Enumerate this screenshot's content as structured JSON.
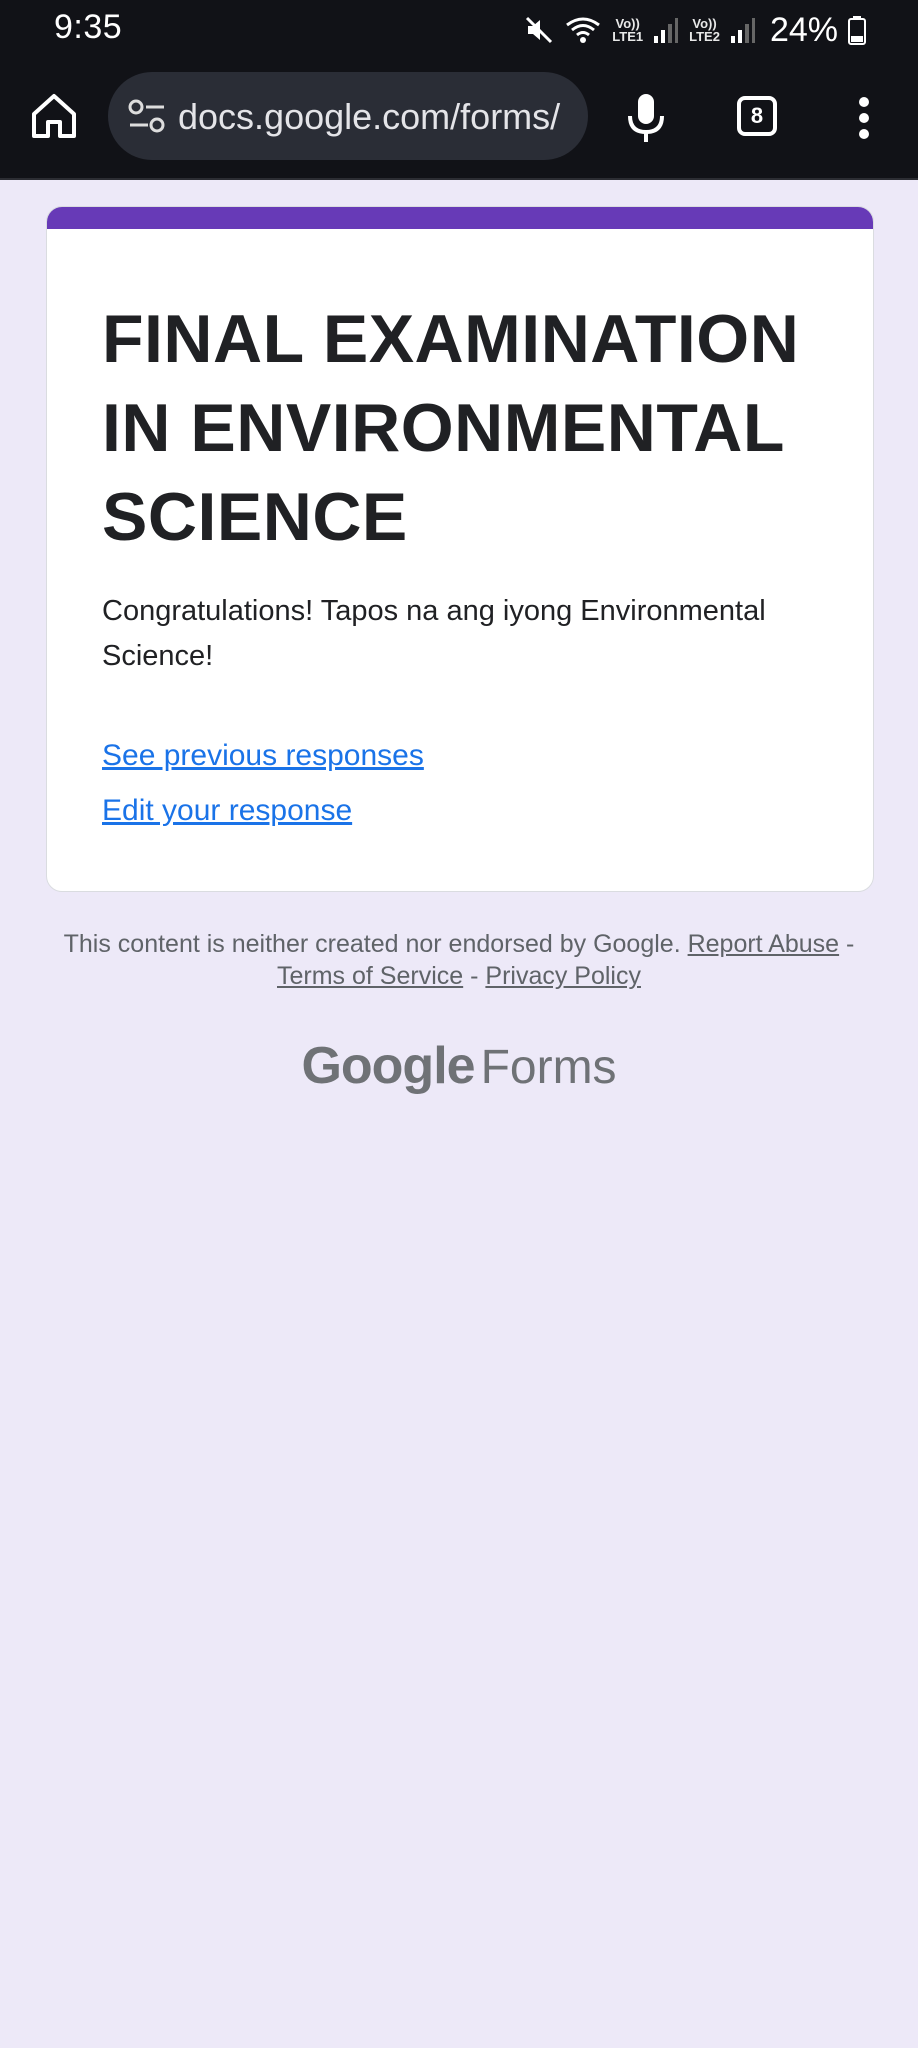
{
  "status_bar": {
    "time": "9:35",
    "net1_top": "Vo))",
    "net1_bottom": "LTE1",
    "net2_top": "Vo))",
    "net2_bottom": "LTE2",
    "battery": "24%"
  },
  "browser": {
    "url": "docs.google.com/forms/",
    "tab_count": "8"
  },
  "form": {
    "title": "FINAL EXAMINATION IN ENVIRONMENTAL SCIENCE",
    "confirmation": "Congratulations! Tapos na ang iyong Environmental Science!",
    "see_previous": "See previous responses",
    "edit_response": "Edit your response"
  },
  "footer": {
    "disclaimer": "This content is neither created nor endorsed by Google.",
    "report_abuse": "Report Abuse",
    "sep1": " - ",
    "terms": "Terms of Service",
    "sep2": " - ",
    "privacy": "Privacy Policy"
  },
  "brand": {
    "google": "Google",
    "forms": "Forms"
  },
  "colors": {
    "accent": "#673ab7",
    "link": "#1a73e8",
    "background": "#ede9f8",
    "browser_chrome": "#111217"
  },
  "icons": {
    "home": "home-icon",
    "site_settings": "tune-icon",
    "mic": "mic-icon",
    "tabs": "tab-switcher-icon",
    "menu": "more-vert-icon",
    "mute": "mute-icon",
    "wifi": "wifi-icon",
    "signal": "signal-icon",
    "battery": "battery-icon"
  }
}
